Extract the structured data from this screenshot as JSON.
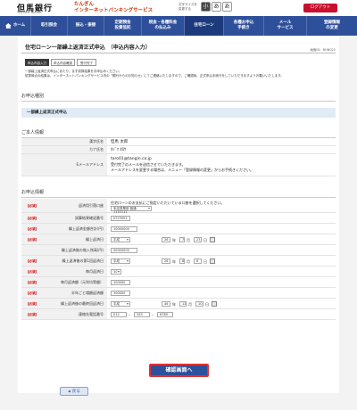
{
  "header": {
    "logo_jp": "但馬銀行",
    "logo_en": "TAJIMA BANK",
    "brand_line1": "たんぎん",
    "brand_line2": "インターネットバンキングサービス",
    "font_size_label_1": "文字サイズを",
    "font_size_label_2": "変更する",
    "font_small": "小",
    "font_mid": "あ",
    "font_big": "あ",
    "logout": "ログアウト"
  },
  "nav": {
    "items": [
      {
        "label": "ホーム"
      },
      {
        "label": "取引照会"
      },
      {
        "label": "振込・振替"
      },
      {
        "label": "定期預金\n投資信託"
      },
      {
        "label": "税金・各種料金\nの払込み"
      },
      {
        "label": "住宅ローン"
      },
      {
        "label": "各種お申込\n手続き"
      },
      {
        "label": "メール\nサービス"
      },
      {
        "label": "登録情報\nの変更"
      }
    ]
  },
  "page": {
    "title": "住宅ローン一部繰上返済正式申込　（申込内容入力）",
    "id": "画面ID：BHN022",
    "steps": [
      "申込内容入力",
      "申込内容確認",
      "受付完了"
    ],
    "note_1": "一部繰上返済正式申込にあたり、まず試算結果をお申込みください。",
    "note_2": "試算時点の結果は、インターネットバンキングサービス内の「銀行からのお知らせ」にてご連絡いたしますので、ご確認後、正式申込手続きをしていただきますようお願いいたします。",
    "section_type": "お申込種別",
    "type_value": "一部繰上返済正式申込",
    "section_personal": "ご本人情報",
    "section_apply": "お申込情報"
  },
  "personal": [
    {
      "label": "漢字氏名",
      "value": "但馬 太郎"
    },
    {
      "label": "カナ氏名",
      "value": "ﾀｼﾞﾏ ﾀﾛｳ"
    },
    {
      "label": "Eメールアドレス",
      "value": "taro01@tangin.co.jp",
      "note_1": "受付完了のメールを送信させていただきます。",
      "note_2": "メールアドレスを変更する場合は、メニュー「登録情報の変更」からお手続きください。"
    }
  ],
  "apply": {
    "required": "【必須】",
    "account_label": "返済用引落口座",
    "account_note": "住宅ローンのお支払にご指定いただいている口座を選択してください。",
    "account_value": "本店営業部 普通 1111111",
    "estimate_label": "試算結果確認番号",
    "estimate_value": "0723001",
    "amount_label": "繰上返済金額合計(円)",
    "amount_value": "10000000",
    "date_label": "繰上返済日",
    "date_era": "平成",
    "date_year": "26",
    "date_month": "7",
    "date_day": "23",
    "unit_year": "年",
    "unit_month": "月",
    "unit_day": "日",
    "principal_label": "繰上返済後の借入残高(円)",
    "principal_value": "50000000",
    "first_date_label": "繰上返済後の第1回返済日",
    "first_era": "平成",
    "first_year": "26",
    "first_month": "8",
    "first_day": "8",
    "payday_label": "毎月返済日",
    "payday_value": "10",
    "monthly_label": "毎月返済額（元利均等額）",
    "monthly_value": "100000",
    "bonus_label": "半年ごと増額返済額",
    "bonus_value": "100000",
    "final_label": "繰上返済後の最終回返済日",
    "final_era": "平成",
    "final_year": "46",
    "final_month": "12",
    "final_day": "10",
    "phone_label": "連絡先電話番号",
    "phone_1": "012",
    "phone_2": "345",
    "phone_3": "6789",
    "phone_sep": "–"
  },
  "buttons": {
    "confirm": "確認画面へ",
    "back": "戻る"
  },
  "colors": {
    "nav_bg": "#2e4f9a",
    "required": "#d00000",
    "confirm_border": "#e03030",
    "logout_bg": "#c8102e"
  }
}
